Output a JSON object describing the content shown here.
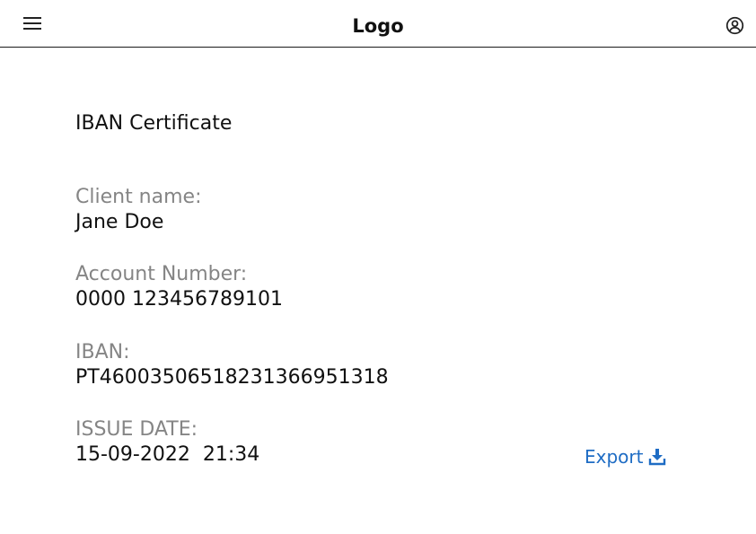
{
  "header": {
    "logo": "Logo",
    "menu_icon": "hamburger-menu-icon",
    "account_icon": "user-circle-icon"
  },
  "certificate": {
    "title": "IBAN Certificate",
    "client_name_label": "Client name:",
    "client_name": "Jane Doe",
    "account_number_label": "Account Number:",
    "account_number": "0000 123456789101",
    "iban_label": "IBAN:",
    "iban": "PT46003506518231366951318",
    "issue_date_label": "ISSUE DATE:",
    "issue_date": "15-09-2022  21:34"
  },
  "actions": {
    "export_label": "Export",
    "export_icon": "download-icon"
  },
  "colors": {
    "label_gray": "#858585",
    "link_blue": "#1e6cc4",
    "text": "#111111",
    "divider": "#1a1a1a"
  }
}
